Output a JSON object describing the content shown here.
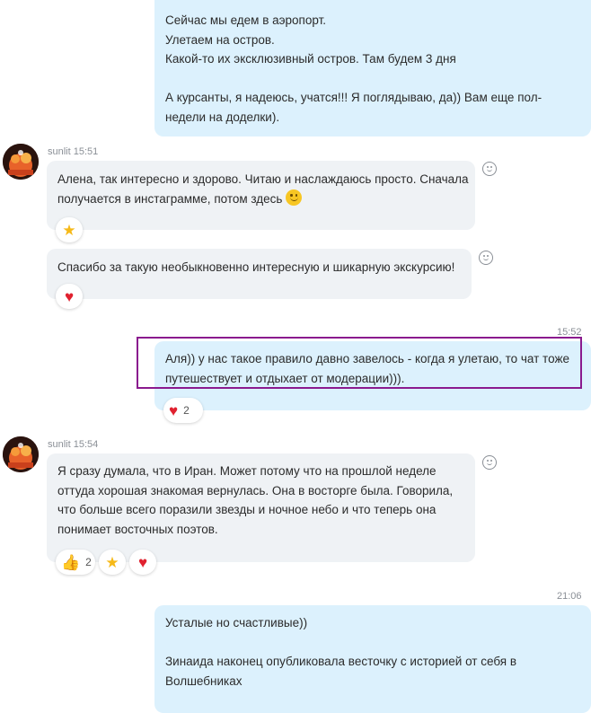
{
  "messages": [
    {
      "lines": [
        "Сейчас мы едем в аэропорт.",
        "Улетаем на остров.",
        "Какой-то их эксклюзивный остров. Там будем 3 дня",
        "",
        "А курсанты, я надеюсь, учатся!!! Я поглядываю, да)) Вам еще пол-",
        "недели на доделки)."
      ]
    },
    {
      "author": "sunlit",
      "time": "15:51",
      "lines": [
        "Алена, так интересно и здорово. Читаю и наслаждаюсь просто. Сначала",
        "получается в инстаграмме, потом здесь"
      ],
      "reaction_icon": "star-icon"
    },
    {
      "lines": [
        "Спасибо за такую необыкновенно интересную и шикарную экскурсию!"
      ],
      "reaction_icon": "heart-icon"
    },
    {
      "time": "15:52",
      "lines": [
        "Аля)) у нас такое правило давно завелось - когда я улетаю, то чат тоже",
        "путешествует и отдыхает от модерации)))."
      ],
      "reaction_icon": "heart-icon",
      "reaction_count": "2"
    },
    {
      "author": "sunlit",
      "time": "15:54",
      "lines": [
        "Я сразу думала, что в Иран. Может потому что на прошлой неделе",
        "оттуда хорошая знакомая вернулась. Она в восторге была. Говорила,",
        "что больше всего поразили звезды и ночное небо и что теперь она",
        "понимает восточных поэтов."
      ],
      "reactions": [
        {
          "icon": "thumbs-up-icon",
          "count": "2"
        },
        {
          "icon": "star-icon"
        },
        {
          "icon": "heart-icon"
        }
      ]
    },
    {
      "time": "21:06",
      "lines": [
        "Усталые но счастливые))",
        "",
        "Зинаида наконец опубликовала весточку с историей от себя в",
        "Волшебниках"
      ]
    }
  ],
  "colors": {
    "outgoing": "#dcf1fd",
    "incoming": "#eff2f5",
    "highlight": "#8a1a8e",
    "heart": "#e0212f",
    "star": "#f6b918"
  }
}
